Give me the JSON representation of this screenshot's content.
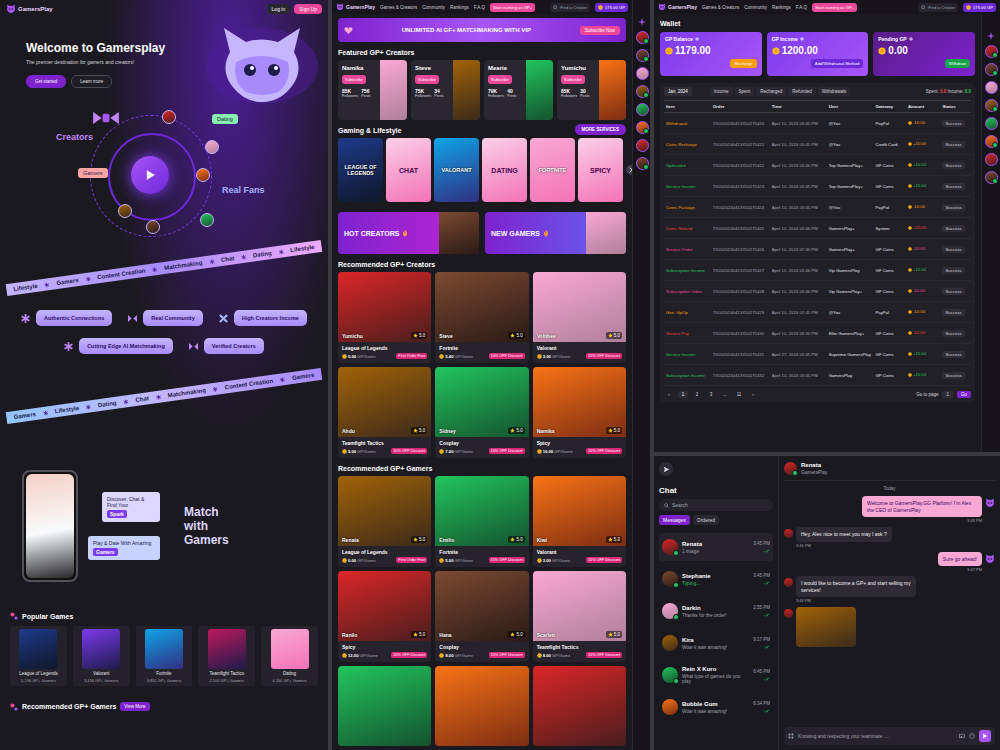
{
  "nav": {
    "logo": "GamersPlay",
    "links": [
      "Games & Creators",
      "Community",
      "Rankings",
      "F.A.Q"
    ],
    "cta": "Start earning as GP+",
    "search": "Find a Creator",
    "login": "Log in",
    "signup": "Sign Up",
    "balance": "175.00 GP"
  },
  "landing": {
    "hero": {
      "title": "Welcome to Gamersplay",
      "subtitle": "The premier destination for gamers and creators!",
      "buttons": [
        {
          "label": "Get started",
          "primary": true
        },
        {
          "label": "Learn more",
          "primary": false
        }
      ]
    },
    "diagram": {
      "creators": "Creators",
      "gamers": "Gamers",
      "dating": "Dating",
      "fans": "Real Fans"
    },
    "ribbons": [
      [
        "Lifestyle",
        "Gamers",
        "Content Creation",
        "Matchmaking",
        "Chat",
        "Dating",
        "Lifestyle"
      ],
      [
        "Gamers",
        "Lifestyle",
        "Dating",
        "Chat",
        "Matchmaking",
        "Content Creation",
        "Gamers"
      ]
    ],
    "features": [
      "Authentic Connections",
      "Real Community",
      "High Creators Income",
      "Cutting Edge AI Matchmaking",
      "Verified Creators"
    ],
    "match": {
      "bubbles": [
        {
          "text": "Discover, Chat & Find Your",
          "highlight": "Spark"
        },
        {
          "text": "Play & Date With Amazing",
          "highlight": "Gamers"
        }
      ],
      "title": [
        "Match",
        "with",
        "Gamers"
      ]
    },
    "popular": {
      "title": "Popular Games",
      "games": [
        {
          "name": "League of Legends",
          "count": "5,196 GP+ Gamers"
        },
        {
          "name": "Valorant",
          "count": "3,436 GP+ Gamers"
        },
        {
          "name": "Fortnite",
          "count": "3,851 GP+ Gamers"
        },
        {
          "name": "Teamfight Tactics",
          "count": "2,100 GP+ Gamers"
        },
        {
          "name": "Dating",
          "count": "4,200 GP+ Gamers"
        }
      ]
    },
    "recommended": {
      "title": "Recommended GP+ Gamers",
      "badge": "View More"
    }
  },
  "market": {
    "banner": {
      "text": "UNLIMITED AI GF+ MATCHMAKING WITH VIP",
      "button": "Subscribe Now"
    },
    "featured": {
      "title": "Featured GP+ Creators",
      "followers_label": "Followers",
      "posts_label": "Posts",
      "items": [
        {
          "name": "Namika",
          "button": "Subscribe",
          "followers": "85K",
          "posts": "756"
        },
        {
          "name": "Steve",
          "button": "Subscribe",
          "followers": "75K",
          "posts": "34"
        },
        {
          "name": "Mearie",
          "button": "Subscribe",
          "followers": "79K",
          "posts": "40"
        },
        {
          "name": "Yumichu",
          "button": "Subscribe",
          "followers": "85K",
          "posts": "30"
        }
      ]
    },
    "categories": {
      "title": "Gaming & Lifestyle",
      "button": "MORE SERVICES",
      "tiles": [
        {
          "label": "LEAGUE OF LEGENDS",
          "kind": "photo"
        },
        {
          "label": "CHAT",
          "kind": "pink"
        },
        {
          "label": "VALORANT",
          "kind": "photo"
        },
        {
          "label": "DATING",
          "kind": "pink"
        },
        {
          "label": "FORTNITE",
          "kind": "photo"
        },
        {
          "label": "SPICY",
          "kind": "pink"
        }
      ]
    },
    "promos": [
      {
        "label": "HOT CREATORS"
      },
      {
        "label": "NEW GAMERS"
      }
    ],
    "creators": {
      "title": "Recommended GP+ Creators",
      "items": [
        {
          "name": "Yumichu",
          "rating": "5.0",
          "game": "League of Legends",
          "price": "0.00",
          "unit": "GP/Game",
          "badge": "First Order Free"
        },
        {
          "name": "Steve",
          "rating": "5.0",
          "game": "Fortnite",
          "price": "5.40",
          "unit": "GP/Game",
          "badge": "10% OFF Discount"
        },
        {
          "name": "Voltibee",
          "rating": "5.0",
          "game": "Valorant",
          "price": "3.00",
          "unit": "GP/Game",
          "badge": "10% OFF Discount"
        },
        {
          "name": "Ahdu",
          "rating": "5.0",
          "game": "Teamfight Tactics",
          "price": "5.00",
          "unit": "GP/Game",
          "badge": "10% OFF Discount"
        },
        {
          "name": "Sidney",
          "rating": "5.0",
          "game": "Cosplay",
          "price": "7.00",
          "unit": "GP/Game",
          "badge": "10% OFF Discount"
        },
        {
          "name": "Namika",
          "rating": "5.0",
          "game": "Spicy",
          "price": "10.00",
          "unit": "GP/Game",
          "badge": "10% OFF Discount"
        }
      ]
    },
    "gamers": {
      "title": "Recommended GP+ Gamers",
      "items": [
        {
          "name": "Renata",
          "rating": "5.0",
          "game": "League of Legends",
          "price": "0.00",
          "unit": "GP/Game",
          "badge": "First Order Free"
        },
        {
          "name": "Emilio",
          "rating": "5.0",
          "game": "Fortnite",
          "price": "5.00",
          "unit": "GP/Game",
          "badge": "10% OFF Discount"
        },
        {
          "name": "Kiwi",
          "rating": "5.0",
          "game": "Valorant",
          "price": "3.00",
          "unit": "GP/Game",
          "badge": "10% OFF Discount"
        },
        {
          "name": "Ranilo",
          "rating": "5.0",
          "game": "Spicy",
          "price": "12.00",
          "unit": "GP/Game",
          "badge": "20% OFF Discount"
        },
        {
          "name": "Hana",
          "rating": "5.0",
          "game": "Cosplay",
          "price": "9.00",
          "unit": "GP/Game",
          "badge": "10% OFF Discount"
        },
        {
          "name": "Scarlett",
          "rating": "5.0",
          "game": "Teamfight Tactics",
          "price": "8.00",
          "unit": "GP/Game",
          "badge": "10% OFF Discount"
        }
      ],
      "cut_row": [
        {
          "kind": "photo"
        },
        {
          "kind": "photo"
        },
        {
          "kind": "photo"
        }
      ]
    }
  },
  "sidebar": [
    {
      "online": true
    },
    {
      "online": true
    },
    {
      "online": false
    },
    {
      "online": true
    },
    {
      "online": false
    },
    {
      "online": true
    },
    {
      "online": false
    },
    {
      "online": true
    }
  ],
  "wallet": {
    "title": "Wallet",
    "cards": [
      {
        "label": "GP Balance",
        "value": "1179.00",
        "button": "Recharge"
      },
      {
        "label": "GP Income",
        "value": "1200.00",
        "button": "Add/Withdrawal Method"
      },
      {
        "label": "Pending GP",
        "value": "0.00",
        "button": "Withdraw"
      }
    ],
    "filter": {
      "month": "Jan, 2024",
      "tabs": [
        {
          "label": "Income",
          "selected": false
        },
        {
          "label": "Spent",
          "selected": false
        },
        {
          "label": "Recharged",
          "selected": false
        },
        {
          "label": "Refunded",
          "selected": false
        },
        {
          "label": "Withdrawals",
          "selected": false
        }
      ],
      "spent_label": "Spent:",
      "spent": "0.0",
      "income_label": "Income:",
      "income": "0.0"
    },
    "columns": [
      "Item",
      "Order",
      "Time",
      "User",
      "Gateway",
      "Amount",
      "Status"
    ],
    "rows": [
      {
        "item": "Withdrawal",
        "color": "#f59e0b",
        "order": "TX0020240413X50275420",
        "time": "April 10, 2024 03:45 PM",
        "user": "@You",
        "gateway": "PayPal",
        "amount": "-10.00",
        "status": "Success"
      },
      {
        "item": "Coins Recharge",
        "color": "#f59e0b",
        "order": "TX0020240413X50275421",
        "time": "April 10, 2024 03:45 PM",
        "user": "@You",
        "gateway": "Credit Card",
        "amount": "+10.00",
        "status": "Success"
      },
      {
        "item": "GpIncome",
        "color": "#22c55e",
        "order": "TX0020240413X50275422",
        "time": "April 10, 2024 03:46 PM",
        "user": "Top GamersPlay+",
        "gateway": "GP Coins",
        "amount": "+10.00",
        "status": "Success"
      },
      {
        "item": "Service Income",
        "color": "#22c55e",
        "order": "TX0020240413X50275423",
        "time": "April 10, 2024 03:45 PM",
        "user": "Top GamersPlay+",
        "gateway": "GP Coins",
        "amount": "+10.00",
        "status": "Success"
      },
      {
        "item": "Coins Package",
        "color": "#f59e0b",
        "order": "TX0020240413X50275424",
        "time": "April 10, 2024 03:45 PM",
        "user": "@You",
        "gateway": "PayPal",
        "amount": "-10.00",
        "status": "Success"
      },
      {
        "item": "Coins Refund",
        "color": "#ef4444",
        "order": "TX0020240413X50275425",
        "time": "April 10, 2024 03:46 PM",
        "user": "GamersPlay+",
        "gateway": "System",
        "amount": "+10.00",
        "status": "Success"
      },
      {
        "item": "Service Order",
        "color": "#ec4899",
        "order": "TX0020240413X50275426",
        "time": "April 10, 2024 07:30 PM",
        "user": "GamersPlay+",
        "gateway": "GP Coins",
        "amount": "-10.00",
        "status": "Success"
      },
      {
        "item": "Subscription Income",
        "color": "#22c55e",
        "order": "TX0020240413X50275427",
        "time": "April 10, 2024 03:46 PM",
        "user": "Vip GamersPlay",
        "gateway": "GP Coins",
        "amount": "+10.00",
        "status": "Success"
      },
      {
        "item": "Subscription Order",
        "color": "#ec4899",
        "order": "TX0020240413X50275428",
        "time": "April 10, 2024 03:46 PM",
        "user": "Vip GamersPlay+",
        "gateway": "GP Coins",
        "amount": "-10.00",
        "status": "Success"
      },
      {
        "item": "Gen. GpOp",
        "color": "#f59e0b",
        "order": "TX0020240413X50275429",
        "time": "April 10, 2024 07:45 PM",
        "user": "@You",
        "gateway": "PayPal",
        "amount": "-10.00",
        "status": "Success"
      },
      {
        "item": "Service Pay",
        "color": "#ef4444",
        "order": "TX0020240413X50275430",
        "time": "April 10, 2024 09:30 PM",
        "user": "Elite GamersPlay+",
        "gateway": "GP Coins",
        "amount": "-10.00",
        "status": "Success"
      },
      {
        "item": "Service Income",
        "color": "#22c55e",
        "order": "TX0020240413X50275431",
        "time": "April 27, 2024 03:45 PM",
        "user": "Supreme GamersPlay",
        "gateway": "GP Coins",
        "amount": "+10.00",
        "status": "Success"
      },
      {
        "item": "Subscription Income",
        "color": "#22c55e",
        "order": "TX0020240413X50275432",
        "time": "April 10, 2024 03:45 PM",
        "user": "GamersPlay",
        "gateway": "GP Coins",
        "amount": "+10.00",
        "status": "Success"
      }
    ],
    "pagination": {
      "prev": "‹",
      "pages": [
        {
          "label": "1",
          "selected": true
        },
        {
          "label": "2",
          "selected": false
        },
        {
          "label": "3",
          "selected": false
        },
        {
          "label": "...",
          "selected": false
        },
        {
          "label": "11",
          "selected": false
        }
      ],
      "next": "›",
      "goto": "Go to page",
      "page": "1",
      "go": "Go"
    }
  },
  "chat": {
    "title": "Chat",
    "search": "Search",
    "tabs": [
      {
        "label": "Messages",
        "selected": true
      },
      {
        "label": "Ordered",
        "selected": false
      }
    ],
    "list": [
      {
        "name": "Renata",
        "time": "3:45 PM",
        "preview": "1 image",
        "online": true,
        "typing": false,
        "selected": true
      },
      {
        "name": "Stephanie",
        "time": "3:45 PM",
        "preview": "Typing...",
        "online": true,
        "typing": true,
        "selected": false
      },
      {
        "name": "Darkin",
        "time": "2:55 PM",
        "preview": "Thanks for the order!",
        "online": true,
        "typing": false,
        "selected": false
      },
      {
        "name": "Kira",
        "time": "9:17 PM",
        "preview": "Wow it was amazing!",
        "online": false,
        "typing": false,
        "selected": false
      },
      {
        "name": "Rein X Kuro",
        "time": "6:45 PM",
        "preview": "What type of games do you play",
        "online": true,
        "typing": false,
        "selected": false
      },
      {
        "name": "Bubble Gum",
        "time": "6:34 PM",
        "preview": "Wow it was amazing!",
        "online": false,
        "typing": false,
        "selected": false
      }
    ],
    "conversation": {
      "name": "Renata",
      "subtitle": "GamersPlay",
      "day": "Today",
      "messages": [
        {
          "side": "me",
          "kind": "text",
          "text": "Welcome to GamersPlay.GG Platform! I'm Alex the CEO of GamersPlay",
          "time": "3:46 PM"
        },
        {
          "side": "them",
          "kind": "text",
          "text": "Hey, Alex nice to meet you may I ask ?",
          "time": "3:46 PM"
        },
        {
          "side": "me",
          "kind": "text",
          "text": "Sure go ahead!",
          "time": "3:47 PM"
        },
        {
          "side": "them",
          "kind": "text",
          "text": "I would like to become a GP+ and start selling my services!",
          "time": "3:48 PM"
        },
        {
          "side": "them",
          "kind": "image"
        }
      ],
      "input": "Knowing and respecting your teammate ...."
    }
  }
}
